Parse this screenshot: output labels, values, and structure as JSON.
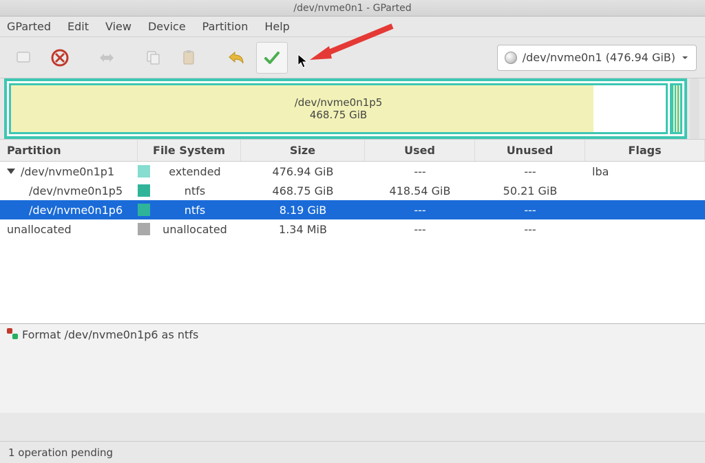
{
  "titlebar": "/dev/nvme0n1 - GParted",
  "menu": {
    "gparted": "GParted",
    "edit": "Edit",
    "view": "View",
    "device": "Device",
    "partition": "Partition",
    "help": "Help"
  },
  "device_selector": {
    "label": "/dev/nvme0n1 (476.94 GiB)"
  },
  "disk_visual": {
    "main_name": "/dev/nvme0n1p5",
    "main_size": "468.75 GiB"
  },
  "columns": {
    "partition": "Partition",
    "filesystem": "File System",
    "size": "Size",
    "used": "Used",
    "unused": "Unused",
    "flags": "Flags"
  },
  "rows": [
    {
      "name": "/dev/nvme0n1p1",
      "indent": 0,
      "expand": true,
      "fs": "extended",
      "swatch": "#86ddd0",
      "size": "476.94 GiB",
      "used": "---",
      "unused": "---",
      "flags": "lba",
      "selected": false
    },
    {
      "name": "/dev/nvme0n1p5",
      "indent": 1,
      "fs": "ntfs",
      "swatch": "#2fb49a",
      "size": "468.75 GiB",
      "used": "418.54 GiB",
      "unused": "50.21 GiB",
      "flags": "",
      "selected": false
    },
    {
      "name": "/dev/nvme0n1p6",
      "indent": 1,
      "fs": "ntfs",
      "swatch": "#2fb49a",
      "size": "8.19 GiB",
      "used": "---",
      "unused": "---",
      "flags": "",
      "selected": true
    },
    {
      "name": "unallocated",
      "indent": 0,
      "fs": "unallocated",
      "swatch": "#a9a9a9",
      "size": "1.34 MiB",
      "used": "---",
      "unused": "---",
      "flags": "",
      "selected": false
    }
  ],
  "pending_op": "Format /dev/nvme0n1p6 as ntfs",
  "statusbar": "1 operation pending"
}
